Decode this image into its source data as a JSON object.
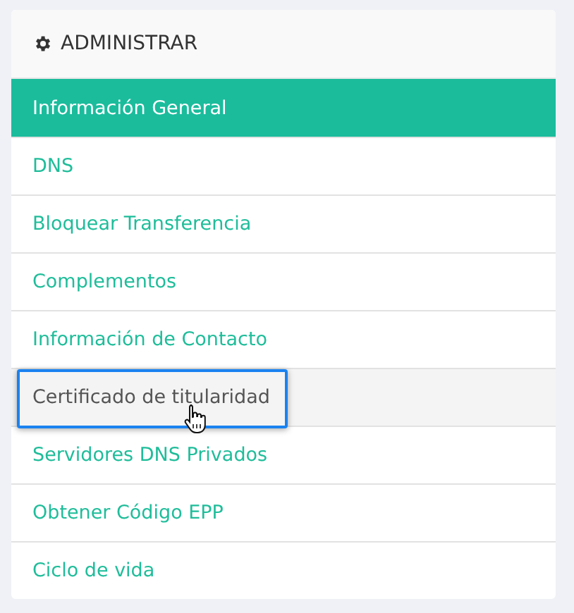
{
  "panel": {
    "title": "ADMINISTRAR",
    "items": [
      {
        "label": "Información General",
        "selected": true,
        "hovered": false
      },
      {
        "label": "DNS",
        "selected": false,
        "hovered": false
      },
      {
        "label": "Bloquear Transferencia",
        "selected": false,
        "hovered": false
      },
      {
        "label": "Complementos",
        "selected": false,
        "hovered": false
      },
      {
        "label": "Información de Contacto",
        "selected": false,
        "hovered": false
      },
      {
        "label": "Certificado de titularidad",
        "selected": false,
        "hovered": true
      },
      {
        "label": "Servidores DNS Privados",
        "selected": false,
        "hovered": false
      },
      {
        "label": "Obtener Código EPP",
        "selected": false,
        "hovered": false
      },
      {
        "label": "Ciclo de vida",
        "selected": false,
        "hovered": false
      }
    ]
  }
}
